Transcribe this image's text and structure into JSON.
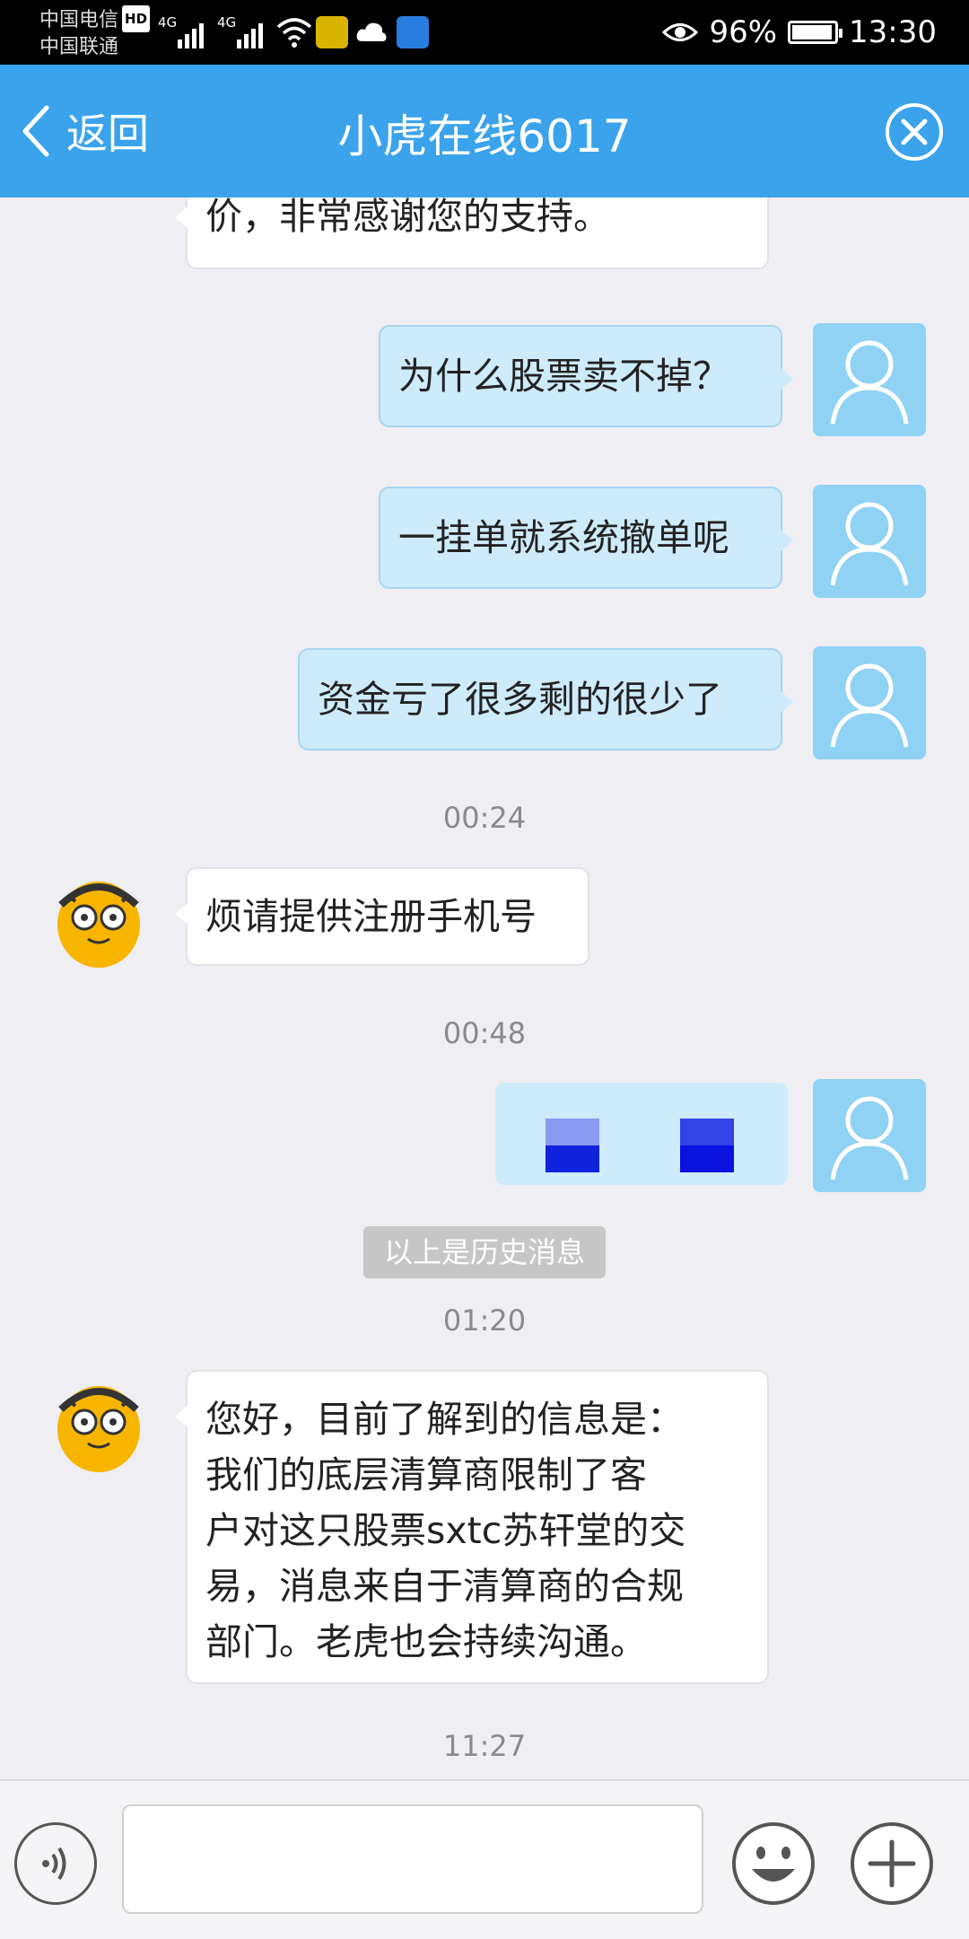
{
  "status_bar": {
    "carrier1": "中国电信",
    "carrier1_badge": "HD",
    "carrier2": "中国联通",
    "net1": "4G",
    "net2": "4G",
    "battery_percent": "96%",
    "battery_level": 0.96,
    "time": "13:30"
  },
  "header": {
    "back_label": "返回",
    "title": "小虎在线6017"
  },
  "messages": {
    "m0": "价，非常感谢您的支持。",
    "m1": "为什么股票卖不掉？",
    "m2": "一挂单就系统撤单呢",
    "m3": "资金亏了很多剩的很少了",
    "t1": "00:24",
    "m4": "烦请提供注册手机号",
    "t2": "00:48",
    "history_note": "以上是历史消息",
    "t3": "01:20",
    "m5_lines": [
      "您好，目前了解到的信息是：",
      "我们的底层清算商限制了客",
      "户对这只股票sxtc苏轩堂的交",
      "易，消息来自于清算商的合规",
      "部门。老虎也会持续沟通。"
    ],
    "t4": "11:27"
  },
  "input_bar": {
    "text_value": ""
  },
  "colors": {
    "header_bg": "#3aa3ec",
    "chat_bg": "#eeeef3",
    "outgoing_bubble": "#cdebfb",
    "user_avatar": "#8fd2f4"
  }
}
